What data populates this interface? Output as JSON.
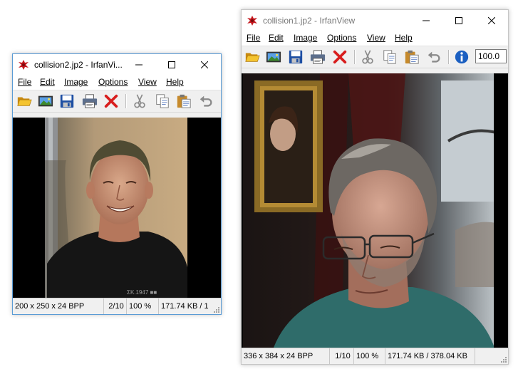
{
  "window_left": {
    "title": "collision2.jp2 - IrfanVi...",
    "menu": [
      "File",
      "Edit",
      "Image",
      "Options",
      "View",
      "Help"
    ],
    "status": {
      "dimensions": "200 x 250 x 24 BPP",
      "index": "2/10",
      "zoom": "100 %",
      "size": "171.74 KB / 1"
    }
  },
  "window_right": {
    "title": "collision1.jp2 - IrfanView",
    "menu": [
      "File",
      "Edit",
      "Image",
      "Options",
      "View",
      "Help"
    ],
    "zoom_value": "100.0",
    "status": {
      "dimensions": "336 x 384 x 24 BPP",
      "index": "1/10",
      "zoom": "100 %",
      "size": "171.74 KB / 378.04 KB"
    }
  },
  "icons": {
    "app": "irfanview-icon",
    "toolbar": [
      "open-folder-icon",
      "slideshow-icon",
      "save-icon",
      "print-icon",
      "delete-icon",
      "cut-icon",
      "copy-icon",
      "paste-icon",
      "undo-icon",
      "info-icon"
    ]
  },
  "colors": {
    "title_bg": "#ffffff",
    "chrome_bg": "#f0f0f0",
    "canvas_bg": "#000000",
    "delete_red": "#d81e1e",
    "info_blue": "#1b5fc1"
  }
}
